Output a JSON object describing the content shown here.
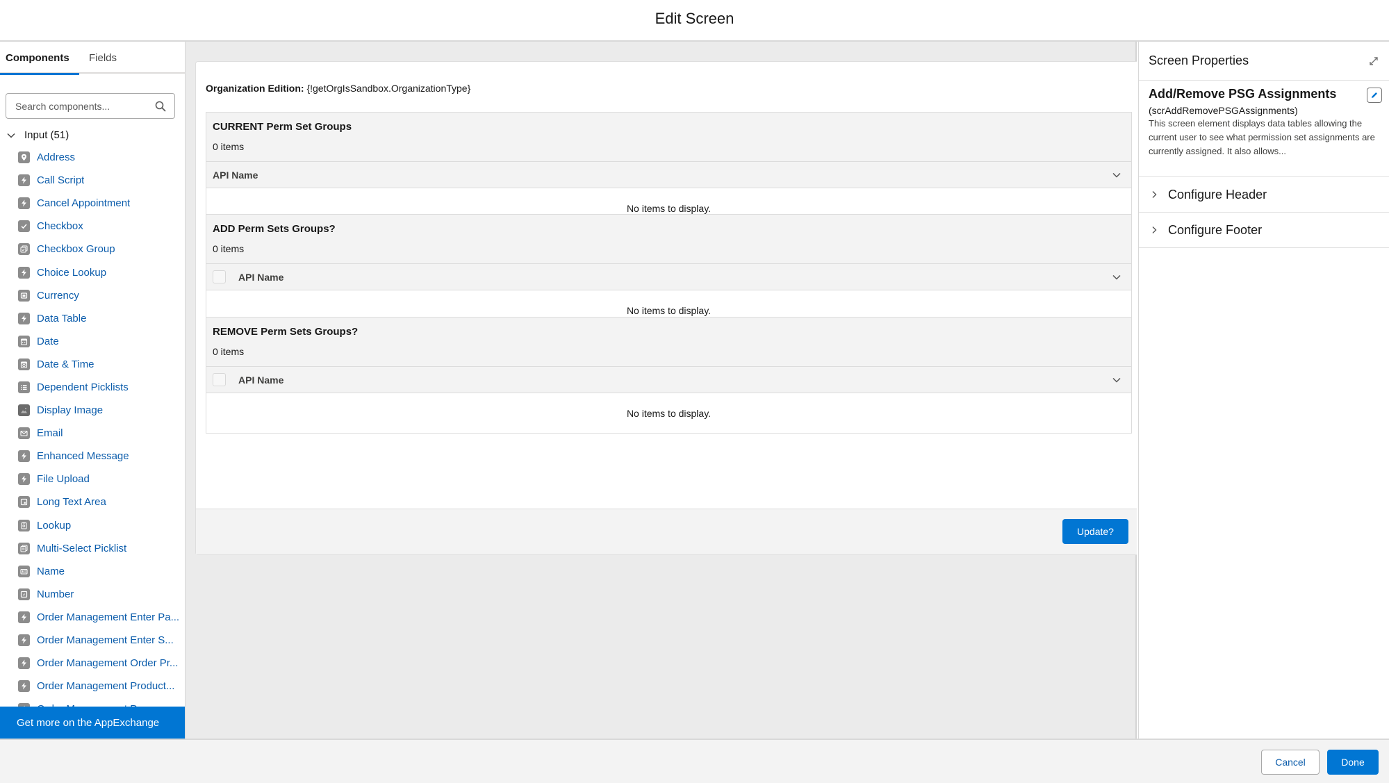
{
  "header": {
    "title": "Edit Screen"
  },
  "left_panel": {
    "tabs": [
      {
        "label": "Components",
        "active": true
      },
      {
        "label": "Fields",
        "active": false
      }
    ],
    "search": {
      "placeholder": "Search components...",
      "value": ""
    },
    "group": {
      "label": "Input (51)",
      "expanded": true
    },
    "items": [
      {
        "label": "Address",
        "icon": "location-icon"
      },
      {
        "label": "Call Script",
        "icon": "lightning-icon"
      },
      {
        "label": "Cancel Appointment",
        "icon": "lightning-icon"
      },
      {
        "label": "Checkbox",
        "icon": "checkbox-icon"
      },
      {
        "label": "Checkbox Group",
        "icon": "checkbox-group-icon"
      },
      {
        "label": "Choice Lookup",
        "icon": "lightning-icon"
      },
      {
        "label": "Currency",
        "icon": "currency-icon"
      },
      {
        "label": "Data Table",
        "icon": "lightning-icon"
      },
      {
        "label": "Date",
        "icon": "date-icon"
      },
      {
        "label": "Date & Time",
        "icon": "datetime-icon"
      },
      {
        "label": "Dependent Picklists",
        "icon": "list-icon"
      },
      {
        "label": "Display Image",
        "icon": "image-icon"
      },
      {
        "label": "Email",
        "icon": "email-icon"
      },
      {
        "label": "Enhanced Message",
        "icon": "lightning-icon"
      },
      {
        "label": "File Upload",
        "icon": "lightning-icon"
      },
      {
        "label": "Long Text Area",
        "icon": "textarea-icon"
      },
      {
        "label": "Lookup",
        "icon": "lookup-icon"
      },
      {
        "label": "Multi-Select Picklist",
        "icon": "multiselect-icon"
      },
      {
        "label": "Name",
        "icon": "name-icon"
      },
      {
        "label": "Number",
        "icon": "number-icon"
      },
      {
        "label": "Order Management Enter Pa...",
        "icon": "lightning-icon"
      },
      {
        "label": "Order Management Enter S...",
        "icon": "lightning-icon"
      },
      {
        "label": "Order Management Order Pr...",
        "icon": "lightning-icon"
      },
      {
        "label": "Order Management Product...",
        "icon": "lightning-icon"
      },
      {
        "label": "Order Management Progres...",
        "icon": "lightning-icon"
      }
    ],
    "appexchange_label": "Get more on the AppExchange"
  },
  "canvas": {
    "org_edition": {
      "label": "Organization Edition:",
      "value": "{!getOrgIsSandbox.OrganizationType}"
    },
    "tables": [
      {
        "title": "CURRENT Perm Set Groups",
        "count": "0 items",
        "column": "API Name",
        "has_checkbox": false,
        "empty_text": "No items to display."
      },
      {
        "title": "ADD Perm Sets Groups?",
        "count": "0 items",
        "column": "API Name",
        "has_checkbox": true,
        "empty_text": "No items to display."
      },
      {
        "title": "REMOVE Perm Sets Groups?",
        "count": "0 items",
        "column": "API Name",
        "has_checkbox": true,
        "empty_text": "No items to display."
      }
    ],
    "update_button": "Update?"
  },
  "right_panel": {
    "title": "Screen Properties",
    "element_name": "Add/Remove PSG Assignments",
    "api_name": "(scrAddRemovePSGAssignments)",
    "description": "This screen element displays data tables allowing the current user to see what permission set assignments are currently assigned. It also allows...",
    "sections": [
      {
        "label": "Configure Header"
      },
      {
        "label": "Configure Footer"
      }
    ]
  },
  "footer": {
    "cancel_label": "Cancel",
    "done_label": "Done"
  },
  "colors": {
    "brand": "#0176d3",
    "link": "#0b5cab",
    "canvas_bg": "#ebebeb",
    "icon_gray": "#8c8c8c"
  }
}
